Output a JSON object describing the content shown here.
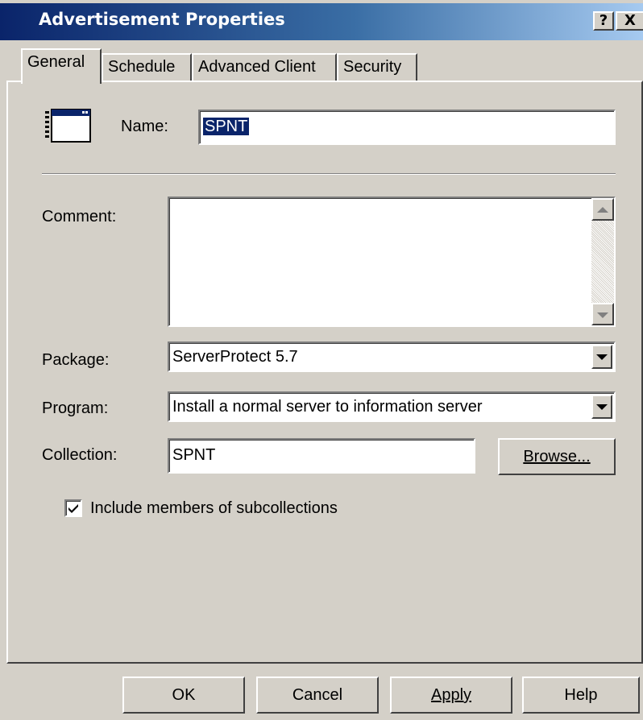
{
  "window": {
    "title": "Advertisement Properties",
    "help_glyph": "?",
    "close_glyph": "X",
    "colors": {
      "titlebar_start": "#0a246a",
      "titlebar_end": "#a6caf0",
      "face": "#d4d0c8",
      "selection": "#0a246a"
    }
  },
  "tabs": [
    {
      "label": "General",
      "active": true
    },
    {
      "label": "Schedule",
      "active": false
    },
    {
      "label": "Advanced Client",
      "active": false
    },
    {
      "label": "Security",
      "active": false
    }
  ],
  "general": {
    "icon": "program-window-icon",
    "name_label": "Name:",
    "name_value": "SPNT",
    "comment_label": "Comment:",
    "comment_value": "",
    "package_label": "Package:",
    "package_value": "ServerProtect 5.7",
    "program_label": "Program:",
    "program_value": "Install a normal server to information server",
    "collection_label": "Collection:",
    "collection_value": "SPNT",
    "browse_label": "Browse...",
    "include_subcollections_label": "Include members of subcollections",
    "include_subcollections_checked": true
  },
  "buttons": {
    "ok": "OK",
    "cancel": "Cancel",
    "apply": "Apply",
    "help": "Help"
  }
}
